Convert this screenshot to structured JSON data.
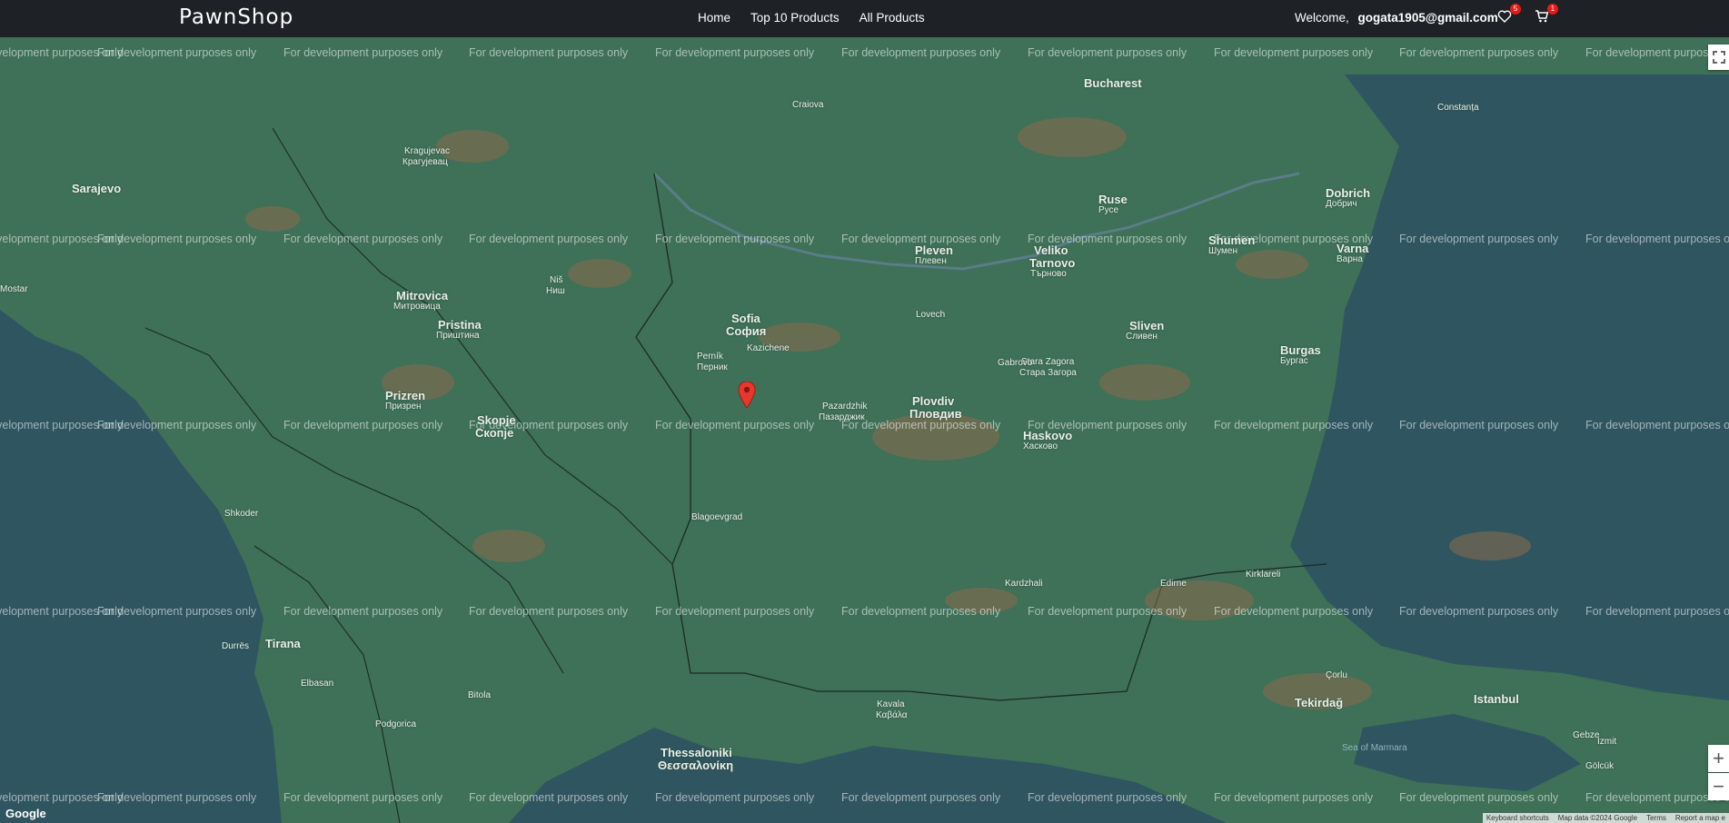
{
  "header": {
    "brand": "PawnShop",
    "nav": [
      "Home",
      "Top 10 Products",
      "All Products"
    ],
    "welcome_label": "Welcome,",
    "user_email": "gogata1905@gmail.com",
    "wishlist_count": "5",
    "cart_count": "1"
  },
  "map": {
    "watermark": "For development purposes only",
    "logo": "Google",
    "footer": {
      "shortcuts": "Keyboard shortcuts",
      "map_data": "Map data ©2024 Google",
      "terms": "Terms",
      "report": "Report a map e"
    },
    "zoom_in": "+",
    "zoom_out": "−",
    "places": {
      "sarajevo": "Sarajevo",
      "bucharest": "Bucharest",
      "ruse": "Ruse",
      "ruse_bg": "Русе",
      "pleven": "Pleven",
      "pleven_bg": "Плевен",
      "shumen": "Shumen",
      "shumen_bg": "Шумен",
      "varna": "Varna",
      "varna_bg": "Варна",
      "dobrich": "Dobrich",
      "dobrich_bg": "Добрич",
      "veliko": "Veliko",
      "tarnovo": "Tarnovo",
      "veliko_bg": "Велико",
      "tarnovo_bg": "Търново",
      "sofia": "Sofia",
      "sofia_bg": "София",
      "pernik": "Perník",
      "pernik_bg": "Перник",
      "plovdiv": "Plovdiv",
      "plovdiv_bg": "Пловдив",
      "burgas": "Burgas",
      "burgas_bg": "Бургас",
      "sliven": "Sliven",
      "sliven_bg": "Сливен",
      "stara_zagora": "Stara Zagora",
      "stara_zagora_bg": "Стара Загора",
      "haskovo": "Haskovo",
      "haskovo_bg": "Хасково",
      "pristina": "Pristina",
      "pristina_bg": "Приштина",
      "mitrovica": "Mitrovica",
      "mitrovica_bg": "Митровица",
      "prizren": "Prizren",
      "prizren_bg": "Призрен",
      "skopje": "Skopje",
      "skopje_bg": "Скопје",
      "tirana": "Tirana",
      "thessaloniki": "Thessaloniki",
      "thessaloniki_gr": "Θεσσαλονίκη",
      "istanbul": "Istanbul",
      "edirne": "Edirne",
      "tekirdag": "Tekirdağ",
      "izmit": "İzmit",
      "craiova": "Craiova",
      "nis": "Niš",
      "nis_sr": "Ниш",
      "kragujevac": "Kragujevac",
      "kragujevac_sr": "Крагујевац",
      "kavala": "Kavala",
      "kavala_gr": "Καβάλα",
      "shkoder": "Shkoder",
      "podgorica": "Podgorica",
      "pazardzhik": "Pazardzhik",
      "pazardzhik_bg": "Пазарджик",
      "kazichene": "Kazichene",
      "sea_of_marmara": "Sea of Marmara",
      "bitola": "Bitola",
      "durres": "Durrës",
      "elbasan": "Elbasan",
      "mostar": "Mostar",
      "constanta": "Constanța",
      "gebze": "Gebze",
      "golcuk": "Gölcük",
      "corlu": "Çorlu",
      "kirklareli": "Kirklareli",
      "kardzhali": "Kardzhali",
      "blagoevgrad": "Blagoevgrad",
      "lovech": "Lovech",
      "gabrovo": "Gabrovo"
    }
  }
}
